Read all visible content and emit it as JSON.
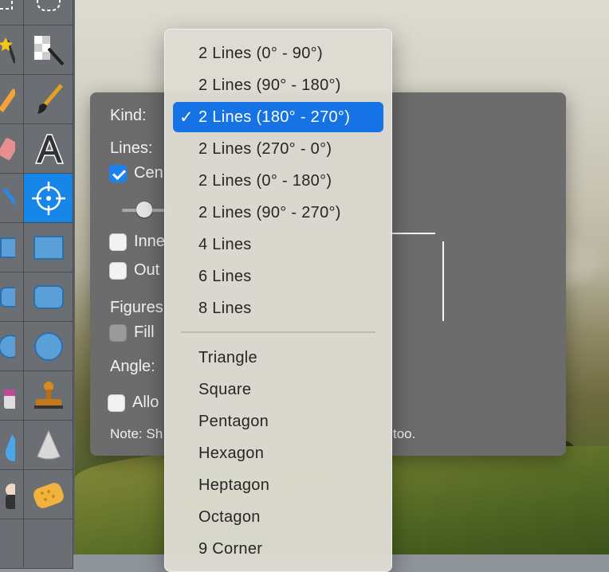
{
  "dialog": {
    "kind_label": "Kind:",
    "lines_label": "Lines:",
    "center_checkbox_label": "Cen",
    "inner_checkbox_label": "Inne",
    "outer_checkbox_label": "Out",
    "figures_label": "Figures",
    "fill_checkbox_label": "Fill",
    "angle_label": "Angle:",
    "allow_checkbox_label": "Allo",
    "note_prefix": "Note: Sh",
    "note_suffix": "too."
  },
  "kind_menu": {
    "selected_index": 2,
    "line_items": [
      "2 Lines (0° - 90°)",
      "2 Lines (90° - 180°)",
      "2 Lines (180° - 270°)",
      "2 Lines (270° - 0°)",
      "2 Lines (0° - 180°)",
      "2 Lines (90° - 270°)",
      "4 Lines",
      "6 Lines",
      "8 Lines"
    ],
    "shape_items": [
      "Triangle",
      "Square",
      "Pentagon",
      "Hexagon",
      "Heptagon",
      "Octagon",
      "9 Corner"
    ],
    "check_glyph": "✓"
  },
  "tools": [
    "rect-select-icon",
    "ellipse-select-icon",
    "magic-wand-icon",
    "checker-wand-icon",
    "pencil-icon",
    "brush-icon",
    "eraser-icon",
    "text-icon",
    "line-icon",
    "crosshair-icon",
    "rectangle-icon",
    "filled-rectangle-icon",
    "rounded-rect-icon",
    "filled-rounded-rect-icon",
    "ellipse-icon",
    "filled-ellipse-icon",
    "paint-bucket-icon",
    "stamp-icon",
    "drop-icon",
    "cone-icon",
    "smudge-icon",
    "sponge-icon"
  ],
  "colors": {
    "accent": "#1673e6",
    "active_tool": "#1686e8",
    "dialog_bg": "#6c6c6c"
  }
}
